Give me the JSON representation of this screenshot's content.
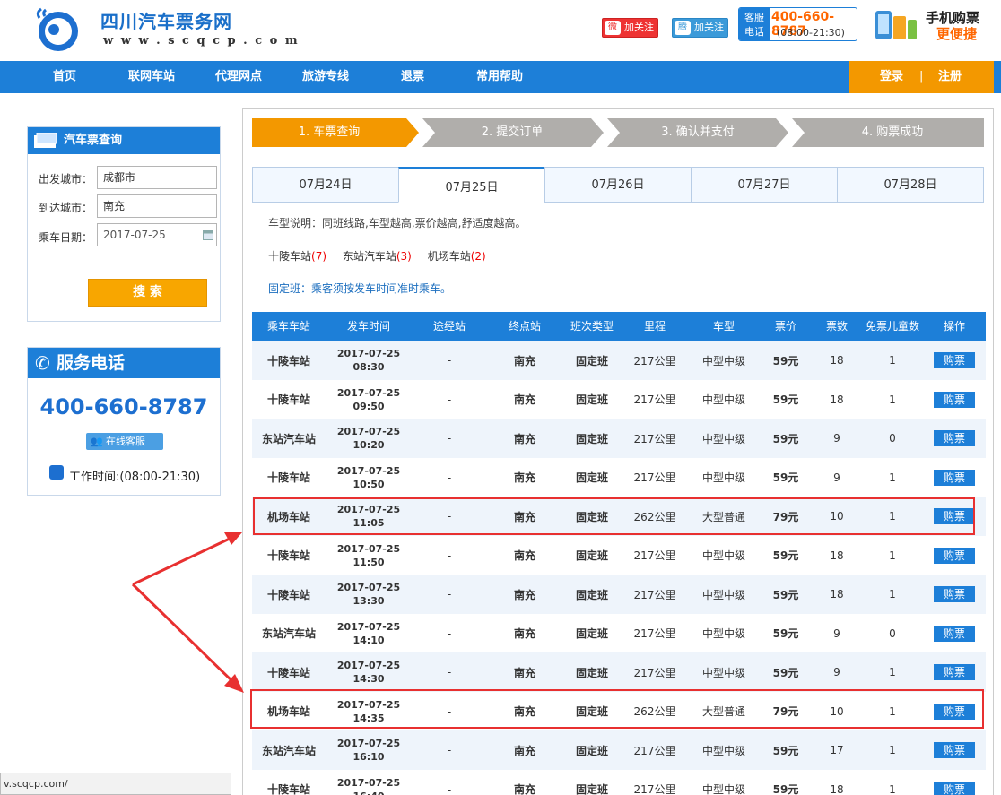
{
  "brand": {
    "title": "四川汽车票务网",
    "url": "w w w . s c q c p . c o m"
  },
  "header": {
    "weibo_follow": "加关注",
    "tqq_follow": "加关注",
    "hotline_tag": "客服电话",
    "hotline_number": "400-660-8787",
    "hotline_hours": "(08:00-21:30)",
    "mobile_line1": "手机购票",
    "mobile_line2": "更便捷"
  },
  "nav": {
    "items": [
      "首页",
      "联网车站",
      "代理网点",
      "旅游专线",
      "退票",
      "常用帮助"
    ],
    "login": "登录",
    "sep": "|",
    "register": "注册"
  },
  "search_panel": {
    "title": "汽车票查询",
    "from_label": "出发城市：",
    "from_value": "成都市",
    "to_label": "到达城市：",
    "to_value": "南充",
    "date_label": "乘车日期：",
    "date_value": "2017-07-25",
    "search_button": "搜 索"
  },
  "service_panel": {
    "title": "服务电话",
    "number": "400-660-8787",
    "online_service": "在线客服",
    "hours": "工作时间:(08:00-21:30)"
  },
  "steps": [
    "1. 车票查询",
    "2. 提交订单",
    "3. 确认并支付",
    "4. 购票成功"
  ],
  "date_tabs": [
    "07月24日",
    "07月25日",
    "07月26日",
    "07月27日",
    "07月28日"
  ],
  "notes": {
    "bus_type": "车型说明：同班线路,车型越高,票价越高,舒适度越高。",
    "fixed": "固定班：乘客须按发车时间准时乘车。"
  },
  "stations": [
    {
      "name": "十陵车站",
      "count": "(7)"
    },
    {
      "name": "东站汽车站",
      "count": "(3)"
    },
    {
      "name": "机场车站",
      "count": "(2)"
    }
  ],
  "table": {
    "headers": [
      "乘车车站",
      "发车时间",
      "途经站",
      "终点站",
      "班次类型",
      "里程",
      "车型",
      "票价",
      "票数",
      "免票儿童数",
      "操作"
    ],
    "buy_label": "购票",
    "rows": [
      {
        "station": "十陵车站",
        "date": "2017-07-25",
        "time": "08:30",
        "via": "-",
        "dest": "南充",
        "type": "固定班",
        "distance": "217公里",
        "bus": "中型中级",
        "price": "59元",
        "tickets": "18",
        "children": "1"
      },
      {
        "station": "十陵车站",
        "date": "2017-07-25",
        "time": "09:50",
        "via": "-",
        "dest": "南充",
        "type": "固定班",
        "distance": "217公里",
        "bus": "中型中级",
        "price": "59元",
        "tickets": "18",
        "children": "1"
      },
      {
        "station": "东站汽车站",
        "date": "2017-07-25",
        "time": "10:20",
        "via": "-",
        "dest": "南充",
        "type": "固定班",
        "distance": "217公里",
        "bus": "中型中级",
        "price": "59元",
        "tickets": "9",
        "children": "0"
      },
      {
        "station": "十陵车站",
        "date": "2017-07-25",
        "time": "10:50",
        "via": "-",
        "dest": "南充",
        "type": "固定班",
        "distance": "217公里",
        "bus": "中型中级",
        "price": "59元",
        "tickets": "9",
        "children": "1"
      },
      {
        "station": "机场车站",
        "date": "2017-07-25",
        "time": "11:05",
        "via": "-",
        "dest": "南充",
        "type": "固定班",
        "distance": "262公里",
        "bus": "大型普通",
        "price": "79元",
        "tickets": "10",
        "children": "1"
      },
      {
        "station": "十陵车站",
        "date": "2017-07-25",
        "time": "11:50",
        "via": "-",
        "dest": "南充",
        "type": "固定班",
        "distance": "217公里",
        "bus": "中型中级",
        "price": "59元",
        "tickets": "18",
        "children": "1"
      },
      {
        "station": "十陵车站",
        "date": "2017-07-25",
        "time": "13:30",
        "via": "-",
        "dest": "南充",
        "type": "固定班",
        "distance": "217公里",
        "bus": "中型中级",
        "price": "59元",
        "tickets": "18",
        "children": "1"
      },
      {
        "station": "东站汽车站",
        "date": "2017-07-25",
        "time": "14:10",
        "via": "-",
        "dest": "南充",
        "type": "固定班",
        "distance": "217公里",
        "bus": "中型中级",
        "price": "59元",
        "tickets": "9",
        "children": "0"
      },
      {
        "station": "十陵车站",
        "date": "2017-07-25",
        "time": "14:30",
        "via": "-",
        "dest": "南充",
        "type": "固定班",
        "distance": "217公里",
        "bus": "中型中级",
        "price": "59元",
        "tickets": "9",
        "children": "1"
      },
      {
        "station": "机场车站",
        "date": "2017-07-25",
        "time": "14:35",
        "via": "-",
        "dest": "南充",
        "type": "固定班",
        "distance": "262公里",
        "bus": "大型普通",
        "price": "79元",
        "tickets": "10",
        "children": "1"
      },
      {
        "station": "东站汽车站",
        "date": "2017-07-25",
        "time": "16:10",
        "via": "-",
        "dest": "南充",
        "type": "固定班",
        "distance": "217公里",
        "bus": "中型中级",
        "price": "59元",
        "tickets": "17",
        "children": "1"
      },
      {
        "station": "十陵车站",
        "date": "2017-07-25",
        "time": "16:40",
        "via": "-",
        "dest": "南充",
        "type": "固定班",
        "distance": "217公里",
        "bus": "中型中级",
        "price": "59元",
        "tickets": "18",
        "children": "1"
      }
    ]
  },
  "status_bar": {
    "url": "v.scqcp.com/"
  },
  "colors": {
    "primary_blue": "#1d7fd8",
    "orange": "#f39800",
    "highlight_red": "#e83030"
  }
}
